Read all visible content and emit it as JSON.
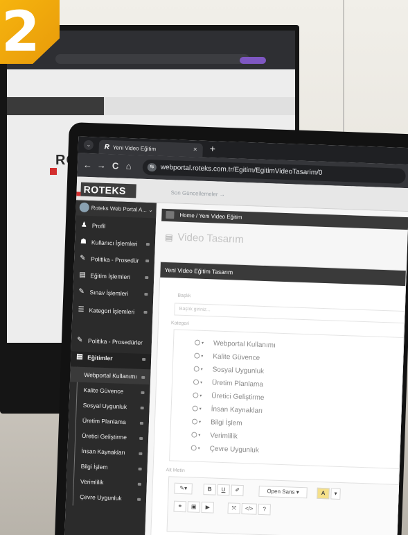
{
  "badge": {
    "number": "2",
    "color": "#f6b40e"
  },
  "back_monitor": {
    "logo": "ROTEKS"
  },
  "browser": {
    "tab_title": "Yeni Video Eğitim",
    "tab_logo": "R",
    "tab_close": "×",
    "new_tab": "+",
    "tablist_glyph": "⌄",
    "back_icon": "←",
    "forward_icon": "→",
    "reload_icon": "C",
    "home_icon": "⌂",
    "site_icon": "⇆",
    "url": "webportal.roteks.com.tr/Egitim/EgitimVideoTasarim/0"
  },
  "header": {
    "logo": "ROTEKS",
    "link": "Son Güncellemeler →"
  },
  "sidebar": {
    "user": "Roteks Web Portal A...",
    "user_caret": "⌄",
    "items": [
      {
        "label": "Profil",
        "icon": "user-icon",
        "glyph": "♟"
      },
      {
        "label": "Kullanıcı İşlemleri",
        "icon": "users-icon",
        "glyph": "☗"
      },
      {
        "label": "Politika - Prosedür",
        "icon": "edit-icon",
        "glyph": "✎"
      },
      {
        "label": "Eğitim İşlemleri",
        "icon": "book-icon",
        "glyph": "▤"
      },
      {
        "label": "Sınav İşlemleri",
        "icon": "edit-icon",
        "glyph": "✎"
      },
      {
        "label": "Kategori İşlemleri",
        "icon": "list-icon",
        "glyph": "☰"
      }
    ],
    "section": [
      {
        "label": "Politika - Prosedürler",
        "icon": "edit-icon",
        "glyph": "✎"
      },
      {
        "label": "Eğitimler",
        "icon": "book-icon",
        "glyph": "▤"
      }
    ],
    "sub_items": [
      "Webportal Kullanımı",
      "Kalite Güvence",
      "Sosyal Uygunluk",
      "Üretim Planlama",
      "Üretici Geliştirme",
      "İnsan Kaynakları",
      "Bilgi İşlem",
      "Verimlilik",
      "Çevre Uygunluk"
    ]
  },
  "main": {
    "breadcrumb": "Home / Yeni Video Eğitim",
    "page_title": "Video Tasarım",
    "page_title_glyph": "▤",
    "panel_title": "Yeni Video Eğitim Tasarım",
    "title_label": "Başlık",
    "title_placeholder": "Başlık giriniz...",
    "category_label": "Kategori",
    "categories": [
      "Webportal Kullanımı",
      "Kalite Güvence",
      "Sosyal Uygunluk",
      "Üretim Planlama",
      "Üretici Geliştirme",
      "İnsan Kaynakları",
      "Bilgi İşlem",
      "Verimlilik",
      "Çevre Uygunluk"
    ],
    "category_caret": "▾",
    "alt_text_label": "Alt Metin",
    "toolbar": {
      "magic": "✎▾",
      "bold": "B",
      "underline": "U",
      "eraser": "✐",
      "font": "Open Sans ▾",
      "color": "A",
      "color_caret": "▾",
      "link": "⚭",
      "image": "▣",
      "video": "▶",
      "fullscreen": "⤧",
      "code": "</>",
      "help": "?"
    }
  }
}
